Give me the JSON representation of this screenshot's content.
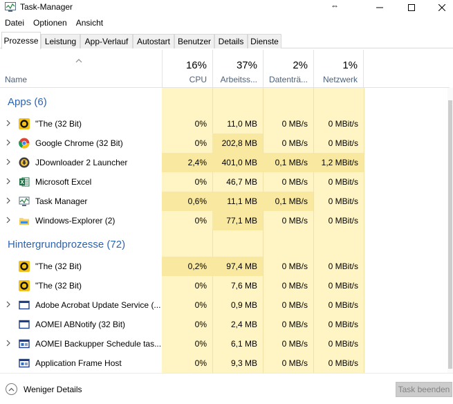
{
  "window": {
    "title": "Task-Manager"
  },
  "menu": [
    "Datei",
    "Optionen",
    "Ansicht"
  ],
  "tabs": [
    "Prozesse",
    "Leistung",
    "App-Verlauf",
    "Autostart",
    "Benutzer",
    "Details",
    "Dienste"
  ],
  "columns": {
    "name": "Name",
    "cpu": {
      "pct": "16%",
      "label": "CPU"
    },
    "mem": {
      "pct": "37%",
      "label": "Arbeitss..."
    },
    "disk": {
      "pct": "2%",
      "label": "Datenträ..."
    },
    "net": {
      "pct": "1%",
      "label": "Netzwerk"
    }
  },
  "groups": {
    "apps": "Apps (6)",
    "background": "Hintergrundprozesse (72)"
  },
  "apps": [
    {
      "name": "\"The (32 Bit)",
      "icon": "yellow-circle-app-icon",
      "cpu": "0%",
      "mem": "11,0 MB",
      "disk": "0 MB/s",
      "net": "0 MBit/s"
    },
    {
      "name": "Google Chrome (32 Bit)",
      "icon": "chrome-icon",
      "cpu": "0%",
      "mem": "202,8 MB",
      "disk": "0 MB/s",
      "net": "0 MBit/s"
    },
    {
      "name": "JDownloader 2 Launcher",
      "icon": "jdownloader-icon",
      "cpu": "2,4%",
      "mem": "401,0 MB",
      "disk": "0,1 MB/s",
      "net": "1,2 MBit/s"
    },
    {
      "name": "Microsoft Excel",
      "icon": "excel-icon",
      "cpu": "0%",
      "mem": "46,7 MB",
      "disk": "0 MB/s",
      "net": "0 MBit/s"
    },
    {
      "name": "Task Manager",
      "icon": "task-manager-icon",
      "cpu": "0,6%",
      "mem": "11,1 MB",
      "disk": "0,1 MB/s",
      "net": "0 MBit/s"
    },
    {
      "name": "Windows-Explorer (2)",
      "icon": "folder-icon",
      "cpu": "0%",
      "mem": "77,1 MB",
      "disk": "0 MB/s",
      "net": "0 MBit/s"
    }
  ],
  "background": [
    {
      "name": "\"The (32 Bit)",
      "icon": "yellow-circle-app-icon",
      "cpu": "0,2%",
      "mem": "97,4 MB",
      "disk": "0 MB/s",
      "net": "0 MBit/s"
    },
    {
      "name": "\"The (32 Bit)",
      "icon": "yellow-circle-app-icon",
      "cpu": "0%",
      "mem": "7,6 MB",
      "disk": "0 MB/s",
      "net": "0 MBit/s"
    },
    {
      "name": "Adobe Acrobat Update Service (...",
      "icon": "window-app-icon",
      "cpu": "0%",
      "mem": "0,9 MB",
      "disk": "0 MB/s",
      "net": "0 MBit/s"
    },
    {
      "name": "AOMEI ABNotify (32 Bit)",
      "icon": "window-app-icon",
      "cpu": "0%",
      "mem": "2,4 MB",
      "disk": "0 MB/s",
      "net": "0 MBit/s"
    },
    {
      "name": "AOMEI Backupper Schedule tas...",
      "icon": "service-app-icon",
      "cpu": "0%",
      "mem": "6,1 MB",
      "disk": "0 MB/s",
      "net": "0 MBit/s"
    },
    {
      "name": "Application Frame Host",
      "icon": "service-app-icon",
      "cpu": "0%",
      "mem": "9,3 MB",
      "disk": "0 MB/s",
      "net": "0 MBit/s"
    }
  ],
  "footer": {
    "less_details": "Weniger Details",
    "end_task": "Task beenden"
  }
}
